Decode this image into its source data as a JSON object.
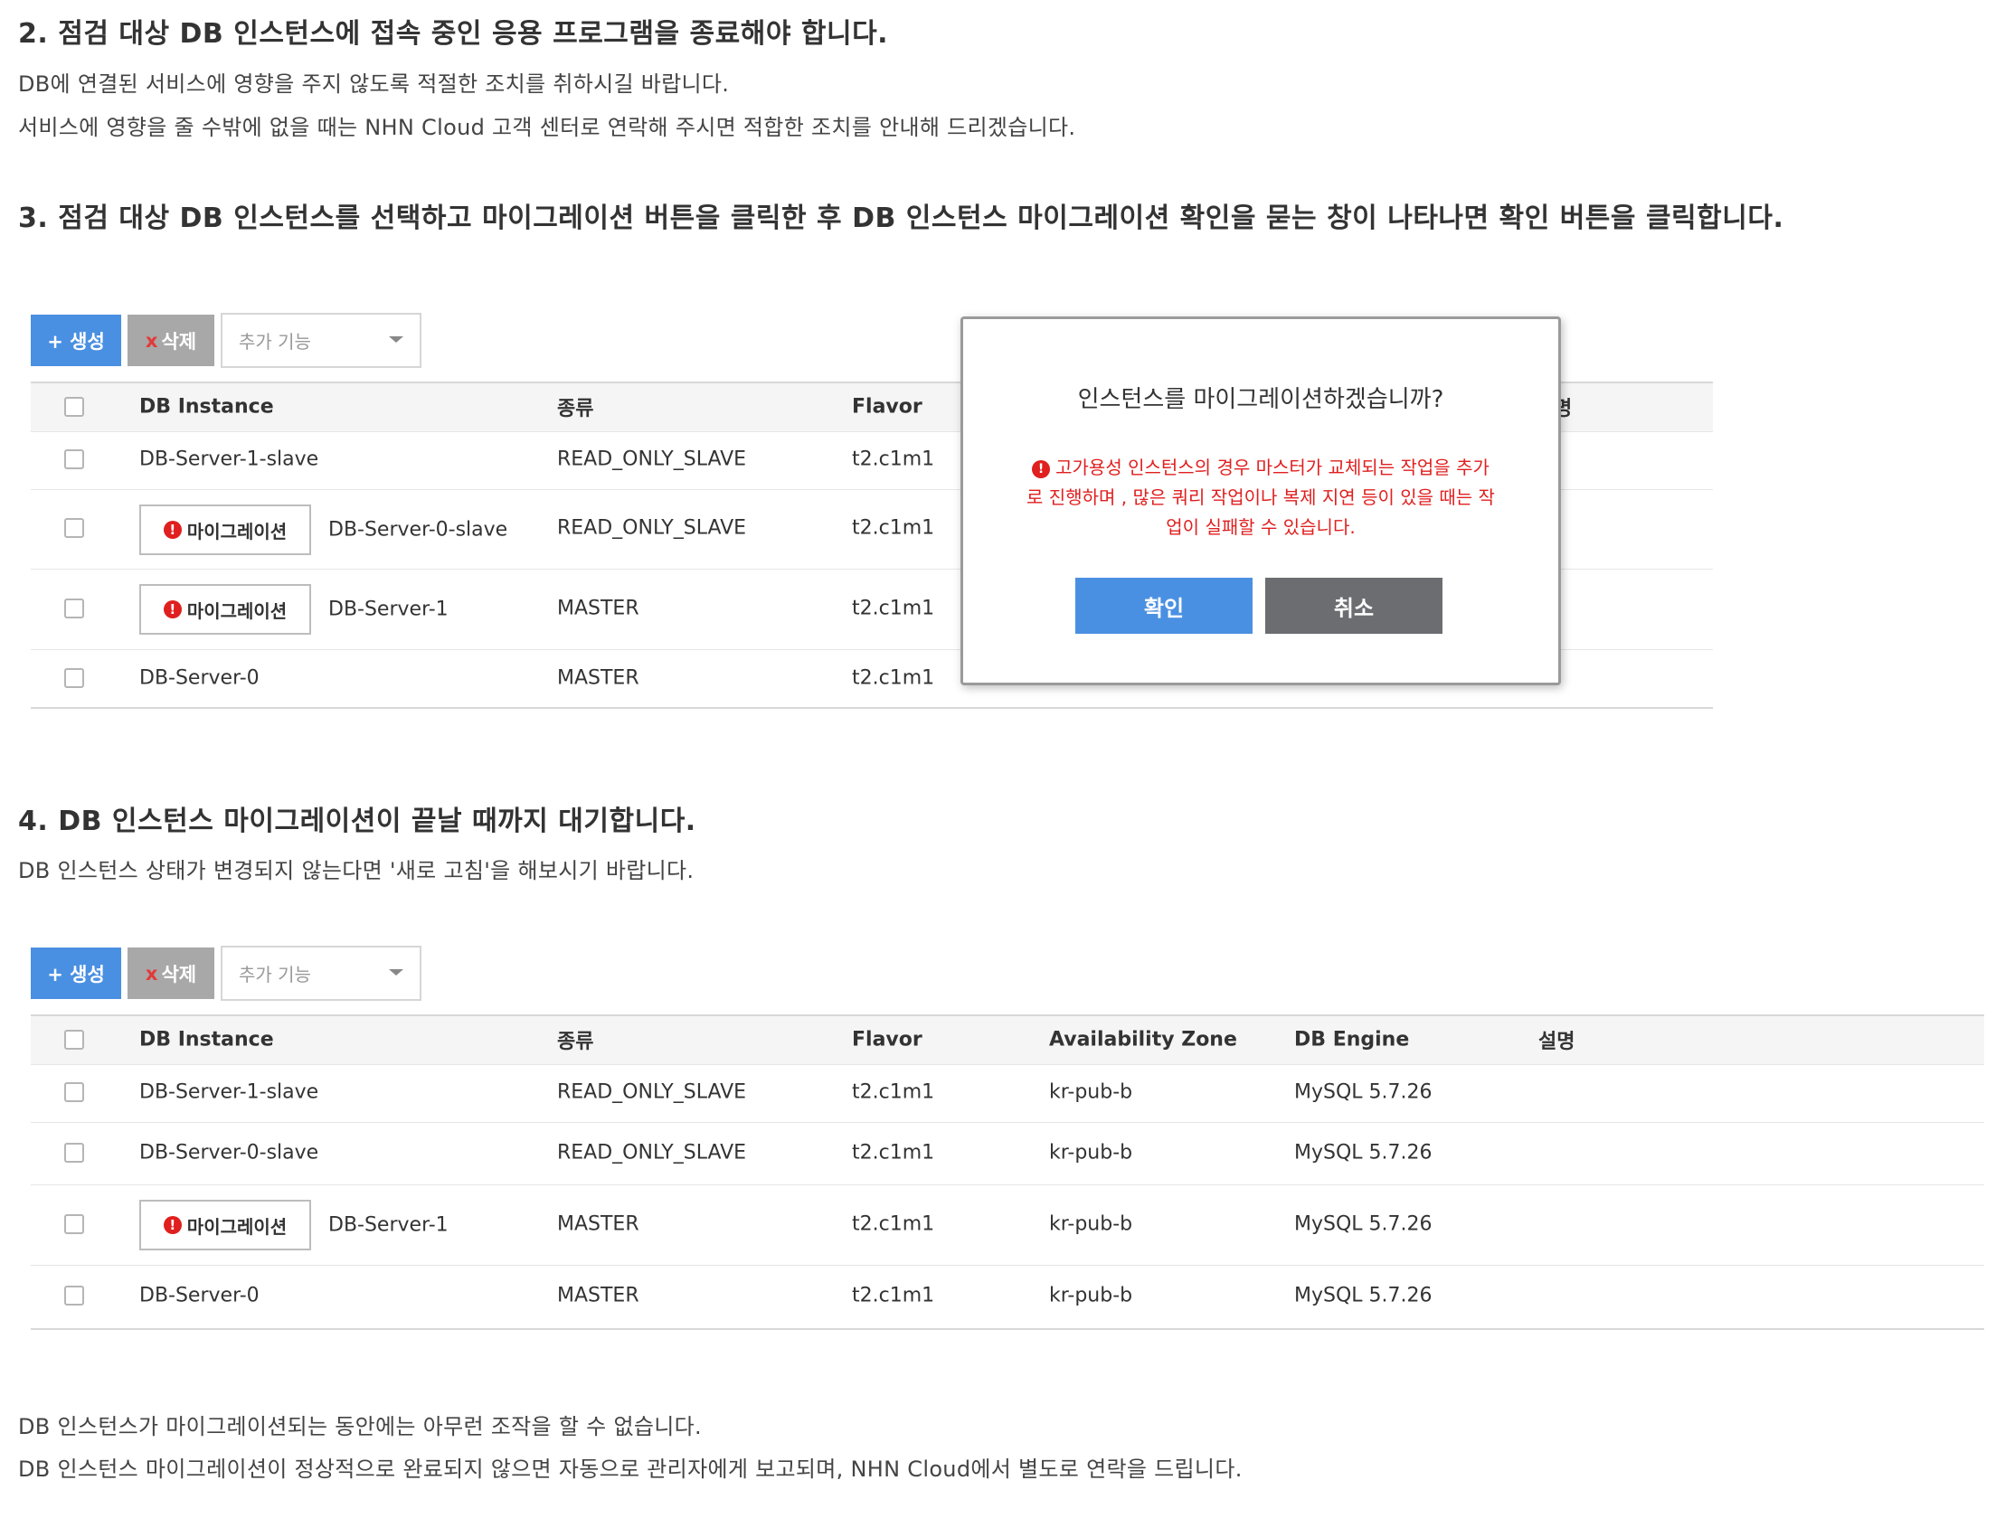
{
  "doc": {
    "step2_heading": "2. 점검 대상 DB 인스턴스에 접속 중인 응용 프로그램을 종료해야 합니다.",
    "step2_p1": "DB에 연결된 서비스에 영향을 주지 않도록 적절한 조치를 취하시길 바랍니다.",
    "step2_p2": "서비스에 영향을 줄 수밖에 없을 때는 NHN Cloud 고객 센터로 연락해 주시면 적합한 조치를 안내해 드리겠습니다.",
    "step3_heading": "3. 점검 대상 DB 인스턴스를 선택하고 마이그레이션 버튼을 클릭한 후 DB 인스턴스 마이그레이션 확인을 묻는 창이 나타나면 확인 버튼을 클릭합니다.",
    "step4_heading": "4. DB 인스턴스 마이그레이션이 끝날 때까지 대기합니다.",
    "step4_p1": "DB 인스턴스 상태가 변경되지 않는다면 '새로 고침'을 해보시기 바랍니다.",
    "footer_p1": "DB 인스턴스가 마이그레이션되는 동안에는 아무런 조작을 할 수 없습니다.",
    "footer_p2": "DB 인스턴스 마이그레이션이 정상적으로 완료되지 않으면 자동으로 관리자에게 보고되며, NHN Cloud에서 별도로 연락을 드립니다."
  },
  "toolbar": {
    "create_label": "+ 생성",
    "delete_x": "x",
    "delete_label": "삭제",
    "more_placeholder": "추가 기능"
  },
  "table": {
    "headers": {
      "instance": "DB Instance",
      "type": "종류",
      "flavor": "Flavor",
      "az": "Availability Zone",
      "engine": "DB Engine",
      "desc": "설명"
    },
    "migrate_label": "마이그레이션",
    "migrate_alert": "!"
  },
  "table1": {
    "header_tail": "명",
    "rows": [
      {
        "instance": "DB-Server-1-slave",
        "type": "READ_ONLY_SLAVE",
        "flavor": "t2.c1m1"
      },
      {
        "instance": "DB-Server-0-slave",
        "type": "READ_ONLY_SLAVE",
        "flavor": "t2.c1m1"
      },
      {
        "instance": "DB-Server-1",
        "type": "MASTER",
        "flavor": "t2.c1m1"
      },
      {
        "instance": "DB-Server-0",
        "type": "MASTER",
        "flavor": "t2.c1m1"
      }
    ]
  },
  "table2": {
    "rows": [
      {
        "instance": "DB-Server-1-slave",
        "type": "READ_ONLY_SLAVE",
        "flavor": "t2.c1m1",
        "az": "kr-pub-b",
        "engine": "MySQL 5.7.26"
      },
      {
        "instance": "DB-Server-0-slave",
        "type": "READ_ONLY_SLAVE",
        "flavor": "t2.c1m1",
        "az": "kr-pub-b",
        "engine": "MySQL 5.7.26"
      },
      {
        "instance": "DB-Server-1",
        "type": "MASTER",
        "flavor": "t2.c1m1",
        "az": "kr-pub-b",
        "engine": "MySQL 5.7.26"
      },
      {
        "instance": "DB-Server-0",
        "type": "MASTER",
        "flavor": "t2.c1m1",
        "az": "kr-pub-b",
        "engine": "MySQL 5.7.26"
      }
    ]
  },
  "modal": {
    "title": "인스턴스를 마이그레이션하겠습니까?",
    "warning_alert": "!",
    "warning_line1": "고가용성 인스턴스의 경우 마스터가 교체되는 작업을 추가",
    "warning_line2": "로 진행하며 , 많은 쿼리 작업이나 복제 지연 등이 있을 때는 작",
    "warning_line3": "업이 실패할 수 있습니다.",
    "ok_label": "확인",
    "cancel_label": "취소"
  },
  "colors": {
    "primary": "#4a90e2",
    "danger": "#e01f1f",
    "cancel": "#6b6d70",
    "disabled": "#a8a8a8"
  }
}
